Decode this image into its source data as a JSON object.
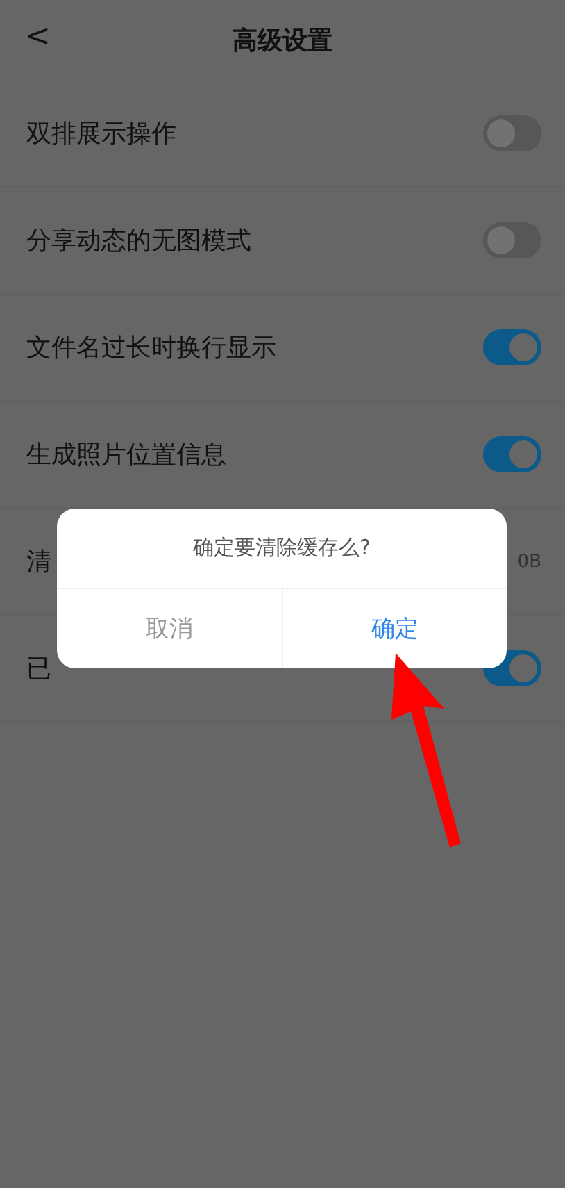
{
  "header": {
    "back": "<",
    "title": "高级设置"
  },
  "settings": [
    {
      "kind": "toggle",
      "label": "双排展示操作",
      "on": false
    },
    {
      "kind": "toggle",
      "label": "分享动态的无图模式",
      "on": false
    },
    {
      "kind": "toggle",
      "label": "文件名过长时换行显示",
      "on": true
    },
    {
      "kind": "toggle",
      "label": "生成照片位置信息",
      "on": true
    },
    {
      "kind": "value",
      "label": "清",
      "value": "0B"
    },
    {
      "kind": "toggle",
      "label": "已",
      "on": true
    }
  ],
  "dialog": {
    "message": "确定要清除缓存么?",
    "buttons": [
      {
        "label": "取消",
        "kind": "cancel"
      },
      {
        "label": "确定",
        "kind": "confirm"
      }
    ]
  }
}
